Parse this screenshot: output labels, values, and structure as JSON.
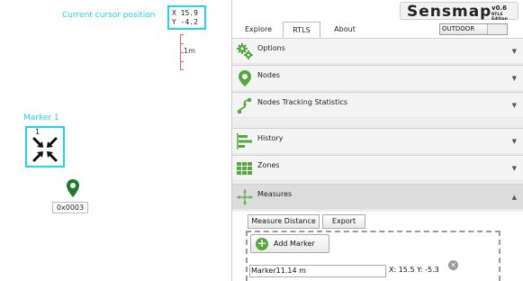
{
  "canvas": {
    "cursor_caption": "Current cursor position",
    "cursor_x": "X 15.9",
    "cursor_y": "Y -4.2",
    "scale_label": "1m",
    "marker_caption": "Marker 1",
    "marker_number": "1",
    "node_label": "0x0003"
  },
  "header": {
    "logo_text": "Sensmap",
    "logo_version": "v0.6",
    "logo_edition": "RTLS Edition",
    "tabs": [
      {
        "label": "Explore",
        "active": false
      },
      {
        "label": "RTLS",
        "active": true
      },
      {
        "label": "About",
        "active": false
      }
    ],
    "mode_button": "OUTDOOR"
  },
  "sections": [
    {
      "title": "Options",
      "icon": "gears-icon",
      "open": false
    },
    {
      "title": "Nodes",
      "icon": "map-pin-icon",
      "open": false
    },
    {
      "title": "Nodes Tracking Statistics",
      "icon": "tracking-path-icon",
      "open": false
    },
    {
      "title": "History",
      "icon": "history-timeline-icon",
      "open": false
    },
    {
      "title": "Zones",
      "icon": "zones-grid-icon",
      "open": false
    },
    {
      "title": "Measures",
      "icon": "measure-crosshair-icon",
      "open": true
    }
  ],
  "measures": {
    "measure_distance_label": "Measure Distance",
    "export_label": "Export",
    "add_marker_label": "Add Marker",
    "marker_field_value": "Marker11.14 m",
    "marker_coords": "X: 15.5 Y: -5.3",
    "remove_icon": "close-circle-icon"
  },
  "colors": {
    "annotation": "#22d4ef",
    "icon_green": "#57a640",
    "pin_green": "#1f7a2e",
    "ruler_red": "#f06262"
  }
}
